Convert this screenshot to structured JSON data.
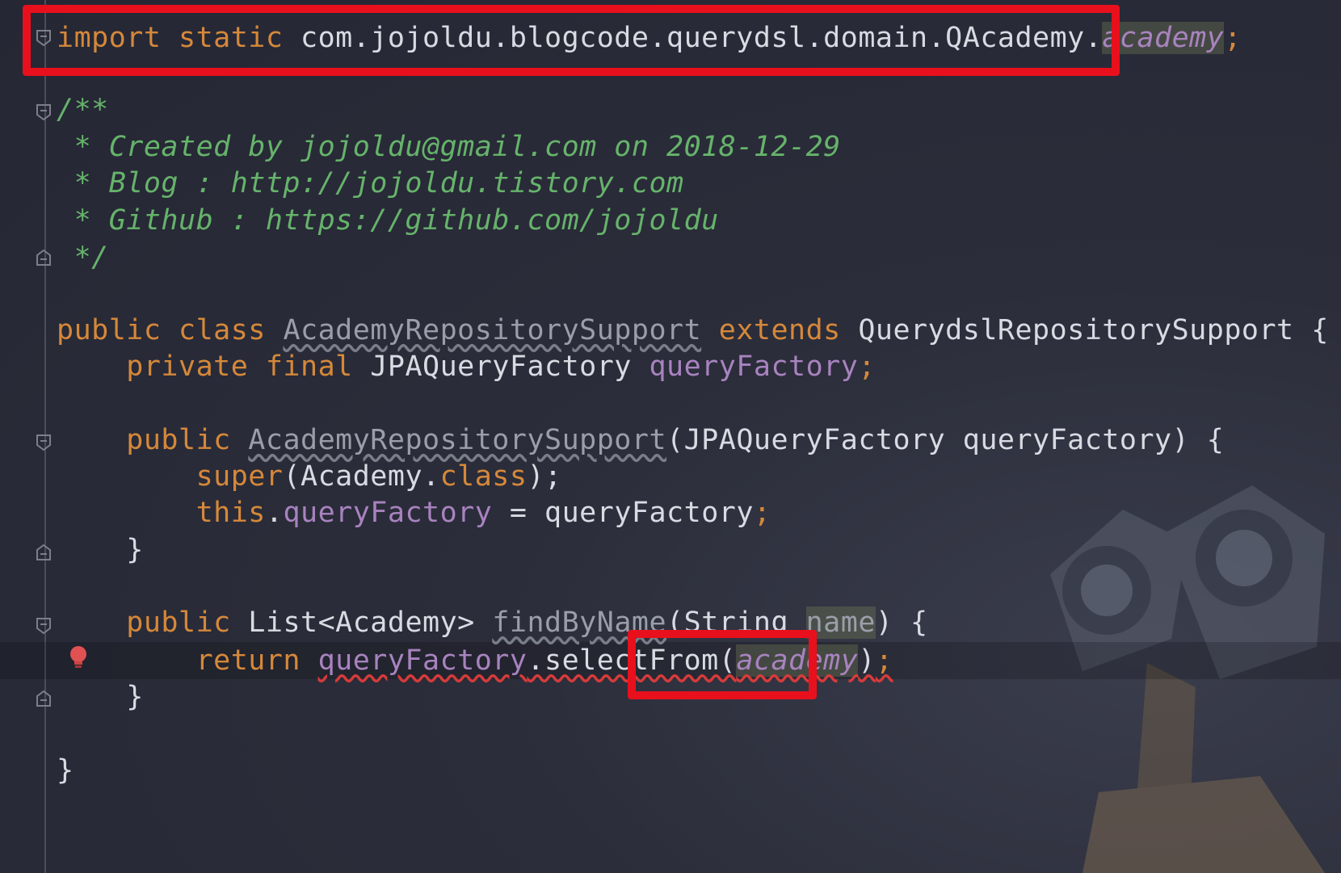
{
  "code": {
    "import": {
      "keyword": "import static ",
      "path": "com.jojoldu.blogcode.querydsl.domain.QAcademy.",
      "member": "academy",
      "semicolon": ";"
    },
    "doc_comment": {
      "open": "/**",
      "line1": " * Created by jojoldu@gmail.com on 2018-12-29",
      "line2": " * Blog : http://jojoldu.tistory.com",
      "line3": " * Github : https://github.com/jojoldu",
      "close": " */"
    },
    "class_decl": {
      "modifiers": "public class ",
      "name": "AcademyRepositorySupport",
      "extends_kw": " extends ",
      "parent": "QuerydslRepositorySupport {"
    },
    "field": {
      "modifiers": "    private final ",
      "type": "JPAQueryFactory ",
      "name": "queryFactory",
      "semicolon": ";"
    },
    "ctor": {
      "modifier": "    public ",
      "name": "AcademyRepositorySupport",
      "params": "(JPAQueryFactory queryFactory) {",
      "super_kw": "        super",
      "super_args_pre": "(Academy.",
      "super_class_kw": "class",
      "super_args_post": ");",
      "this_kw": "        this",
      "this_dot": ".",
      "this_field": "queryFactory",
      "assign": " = queryFactory",
      "semicolon": ";",
      "close": "    }"
    },
    "method": {
      "modifier": "    public ",
      "ret_type": "List<Academy> ",
      "name": "findByName",
      "params_pre": "(String ",
      "param_name": "name",
      "params_post": ") {",
      "return_kw": "        return ",
      "target": "queryFactory",
      "call": ".selectFrom(",
      "arg": "academy",
      "call_end": ")",
      "semicolon": ";",
      "close": "    }"
    },
    "class_close": "}"
  },
  "icons": {
    "fold": "fold-marker-icon",
    "bulb": "lightbulb-icon"
  },
  "colors": {
    "highlight_box": "#e8101c",
    "keyword": "#d5883a",
    "field": "#a883bf",
    "comment": "#66b36b"
  }
}
